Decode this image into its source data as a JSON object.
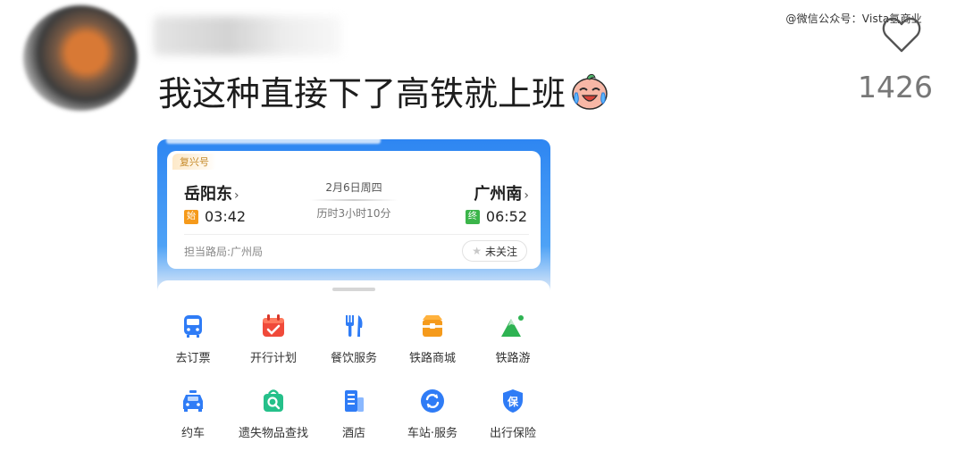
{
  "watermark": "@微信公众号：Vista氢商业",
  "comment": {
    "text": "我这种直接下了高铁就上班",
    "emoji": "crying-laughing-face-emoji",
    "likes": "1426"
  },
  "ticket": {
    "train_type": "复兴号",
    "from_station": "岳阳东",
    "to_station": "广州南",
    "chevron": "›",
    "date": "2月6日周四",
    "duration": "历时3小时10分",
    "start_badge": "始",
    "end_badge": "终",
    "depart_time": "03:42",
    "arrive_time": "06:52",
    "bureau": "担当路局:广州局",
    "follow_label": "未关注"
  },
  "services": [
    {
      "label": "去订票",
      "icon": "ticket-train-icon",
      "color": "#2f7cf6"
    },
    {
      "label": "开行计划",
      "icon": "calendar-check-icon",
      "color": "#f04a3a"
    },
    {
      "label": "餐饮服务",
      "icon": "fork-knife-icon",
      "color": "#2f7cf6"
    },
    {
      "label": "铁路商城",
      "icon": "shop-bag-icon",
      "color": "#f59a1b"
    },
    {
      "label": "铁路游",
      "icon": "mountain-icon",
      "color": "#2eb352"
    },
    {
      "label": "约车",
      "icon": "car-icon",
      "color": "#2f7cf6"
    },
    {
      "label": "遗失物品查找",
      "icon": "lost-bag-search-icon",
      "color": "#25c08a"
    },
    {
      "label": "酒店",
      "icon": "hotel-building-icon",
      "color": "#2f7cf6"
    },
    {
      "label": "车站·服务",
      "icon": "station-service-icon",
      "color": "#2f7cf6"
    },
    {
      "label": "出行保险",
      "icon": "insurance-shield-icon",
      "color": "#2f7cf6"
    }
  ]
}
